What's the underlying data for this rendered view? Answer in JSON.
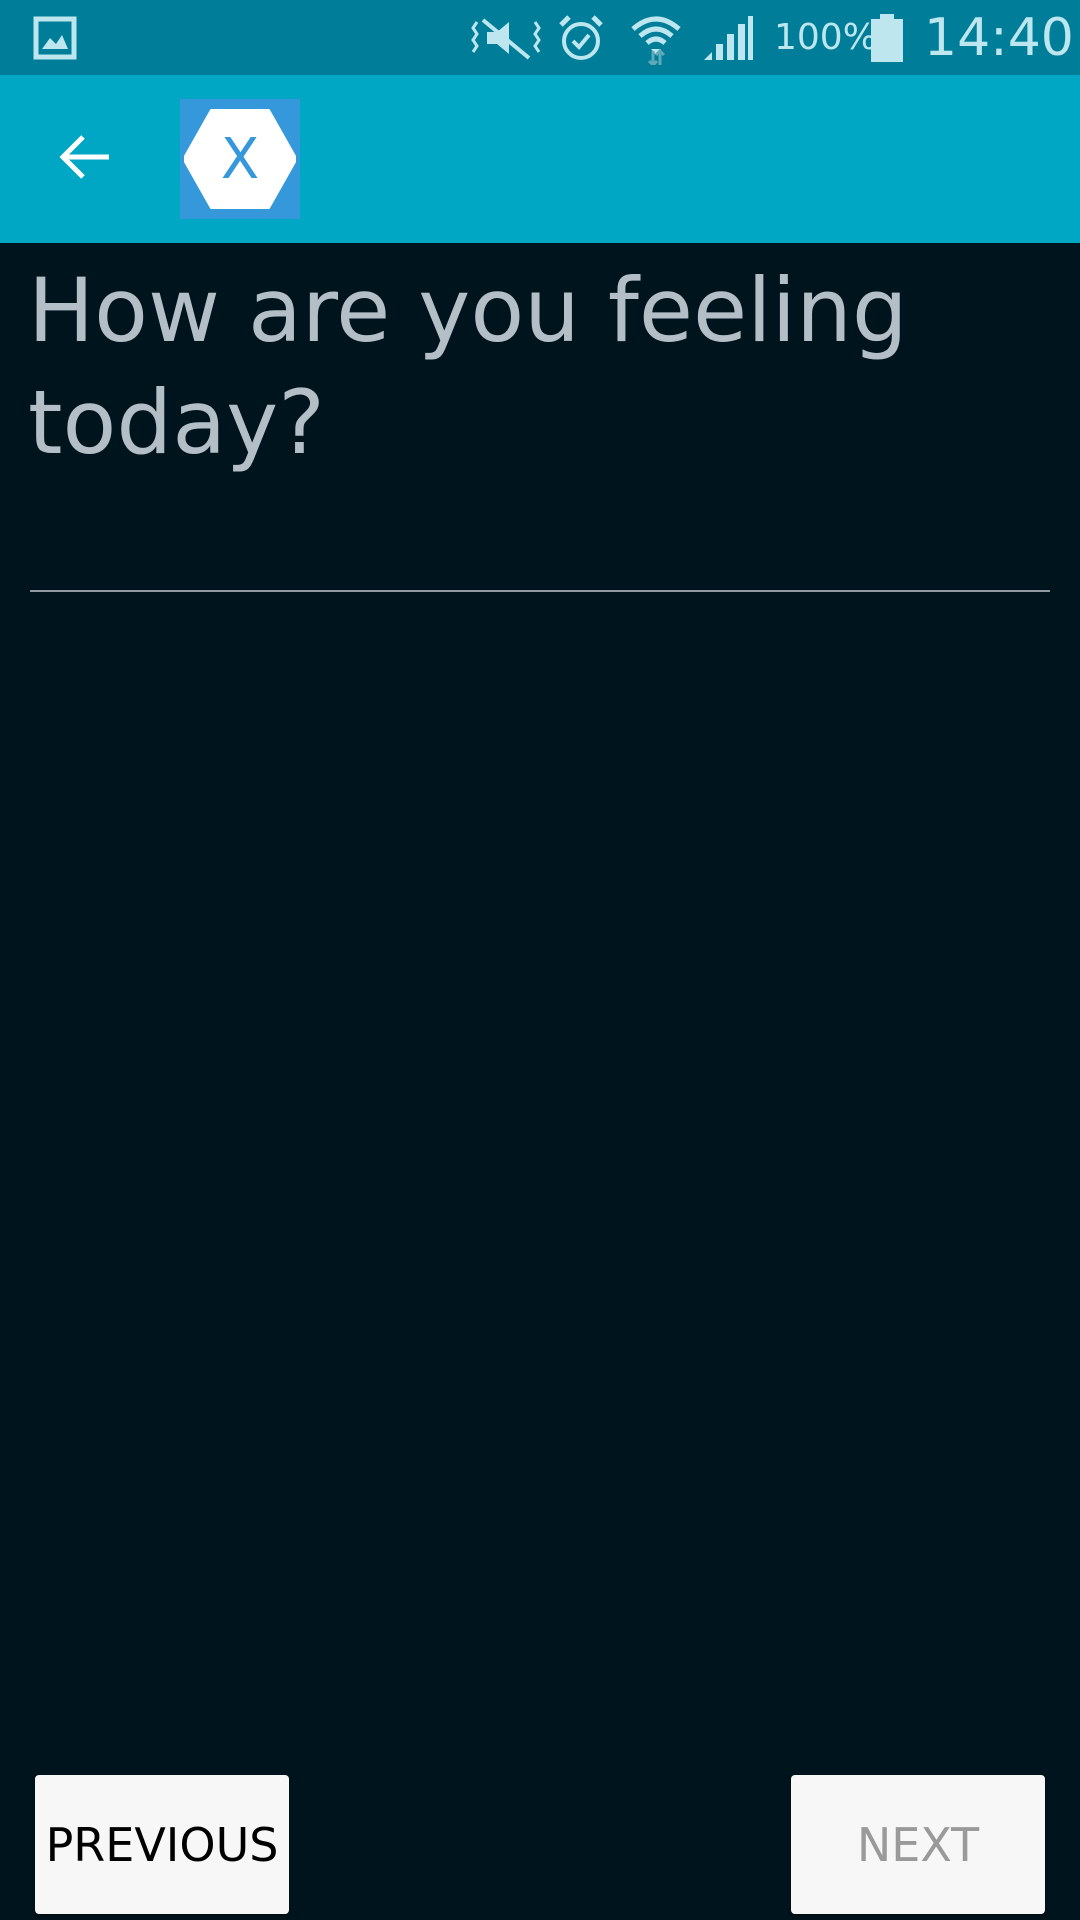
{
  "status_bar": {
    "battery_percent": "100%",
    "time": "14:40",
    "icons": [
      "gallery-icon",
      "vibrate-mute-icon",
      "alarm-icon",
      "wifi-icon",
      "signal-icon",
      "battery-icon"
    ]
  },
  "app_bar": {
    "back_icon": "arrow-back-icon",
    "logo_letter": "X"
  },
  "main": {
    "question": "How are you feeling today?",
    "answer_value": "",
    "answer_placeholder": ""
  },
  "nav": {
    "previous_label": "PREVIOUS",
    "next_label": "NEXT"
  },
  "colors": {
    "status_bar_bg": "#007e99",
    "app_bar_bg": "#00a7c5",
    "background": "#00141d",
    "logo_bg": "#3498db",
    "question_text": "#b4bec6"
  }
}
